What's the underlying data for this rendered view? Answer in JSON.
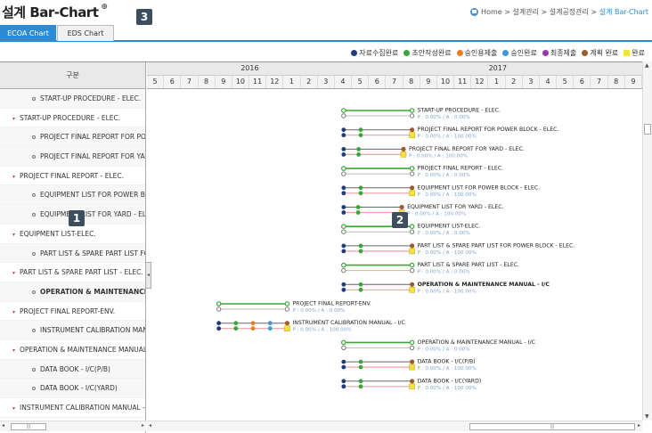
{
  "header": {
    "title": "설계 Bar-Chart",
    "title_mark": "⊕",
    "breadcrumb": {
      "home": "Home",
      "l1": "설계관리",
      "l2": "설계공정관리",
      "current": "설계 Bar-Chart",
      "sep": " > "
    }
  },
  "badges": [
    "1",
    "2",
    "3"
  ],
  "tabs": [
    {
      "label": "ECOA Chart",
      "active": true
    },
    {
      "label": "EDS Chart",
      "active": false
    }
  ],
  "legend": [
    {
      "label": "자료수집완료",
      "color": "#1f3c7a",
      "shape": "dot"
    },
    {
      "label": "초안작성완료",
      "color": "#3aa63a",
      "shape": "dot"
    },
    {
      "label": "승인용제출",
      "color": "#ee7d20",
      "shape": "dot"
    },
    {
      "label": "승인완료",
      "color": "#3a9ad9",
      "shape": "dot"
    },
    {
      "label": "최종제출",
      "color": "#9b33b5",
      "shape": "dot"
    },
    {
      "label": "계획 완료",
      "color": "#a05a2c",
      "shape": "dot"
    },
    {
      "label": "완료",
      "color": "#f4e43a",
      "shape": "square"
    }
  ],
  "left_header": "구분",
  "rows": [
    {
      "label": "START-UP PROCEDURE - ELEC.",
      "kind": "child"
    },
    {
      "label": "START-UP PROCEDURE - ELEC.",
      "kind": "parent"
    },
    {
      "label": "PROJECT FINAL REPORT FOR POWER BLOCK - ELEC.",
      "kind": "child"
    },
    {
      "label": "PROJECT FINAL REPORT FOR YARD - ELEC.",
      "kind": "child"
    },
    {
      "label": "PROJECT FINAL REPORT - ELEC.",
      "kind": "parent"
    },
    {
      "label": "EQUIPMENT LIST FOR POWER BLOCK - ELEC.",
      "kind": "child"
    },
    {
      "label": "EQUIPMENT LIST FOR YARD - ELEC.",
      "kind": "child"
    },
    {
      "label": "EQUIPMENT LIST-ELEC.",
      "kind": "parent"
    },
    {
      "label": "PART LIST & SPARE PART LIST FOR POWER BLOCK - ELEC.",
      "kind": "child"
    },
    {
      "label": "PART LIST & SPARE PART LIST - ELEC.",
      "kind": "parent"
    },
    {
      "label": "OPERATION & MAINTENANCE MANUAL - I/C",
      "kind": "child",
      "bold": true
    },
    {
      "label": "PROJECT FINAL REPORT-ENV.",
      "kind": "parent"
    },
    {
      "label": "INSTRUMENT CALIBRATION MANUAL - I/C",
      "kind": "child"
    },
    {
      "label": "OPERATION & MAINTENANCE MANUAL - I/C",
      "kind": "parent"
    },
    {
      "label": "DATA BOOK - I/C(P/B)",
      "kind": "child"
    },
    {
      "label": "DATA BOOK - I/C(YARD)",
      "kind": "child"
    },
    {
      "label": "INSTRUMENT CALIBRATION MANUAL - I/C",
      "kind": "parent"
    }
  ],
  "timeline": {
    "years": [
      {
        "label": "2016",
        "start_index": 0,
        "span": 12
      },
      {
        "label": "2017",
        "start_index": 12,
        "span": 17
      }
    ],
    "months": [
      "5",
      "6",
      "7",
      "8",
      "9",
      "10",
      "11",
      "12",
      "1",
      "2",
      "3",
      "4",
      "5",
      "6",
      "7",
      "8",
      "9",
      "10",
      "11",
      "12",
      "1",
      "2",
      "3",
      "4",
      "5",
      "6",
      "7",
      "8",
      "9"
    ]
  },
  "bars": [
    {
      "title": "START-UP PROCEDURE - ELEC.",
      "status": "P : 0.00% / A : 0.00%",
      "start": 11.5,
      "end": 15.5,
      "type": "plain",
      "bold": false
    },
    {
      "title": "PROJECT FINAL REPORT FOR POWER BLOCK - ELEC.",
      "status": "P : 0.00% / A : 100.00%",
      "start": 11.5,
      "end": 15.5,
      "type": "dots",
      "bold": false
    },
    {
      "title": "PROJECT FINAL REPORT FOR YARD - ELEC.",
      "status": "P : 0.00% / A : 100.00%",
      "start": 11.5,
      "end": 15.0,
      "type": "dots",
      "bold": false
    },
    {
      "title": "PROJECT FINAL REPORT - ELEC.",
      "status": "P : 0.00% / A : 0.00%",
      "start": 11.5,
      "end": 15.5,
      "type": "plain",
      "bold": false
    },
    {
      "title": "EQUIPMENT LIST FOR POWER BLOCK - ELEC.",
      "status": "P : 0.00% / A : 100.00%",
      "start": 11.5,
      "end": 15.5,
      "type": "dots",
      "bold": false
    },
    {
      "title": "EQUIPMENT LIST FOR YARD - ELEC.",
      "status": "P : 0.00% / A : 100.00%",
      "start": 11.5,
      "end": 14.9,
      "type": "dots",
      "bold": false
    },
    {
      "title": "EQUIPMENT LIST-ELEC.",
      "status": "P : 0.00% / A : 0.00%",
      "start": 11.5,
      "end": 15.5,
      "type": "plain",
      "bold": false
    },
    {
      "title": "PART LIST & SPARE PART LIST FOR POWER BLOCK - ELEC.",
      "status": "P : 0.00% / A : 100.00%",
      "start": 11.5,
      "end": 15.5,
      "type": "dots",
      "bold": false
    },
    {
      "title": "PART LIST & SPARE PART LIST - ELEC.",
      "status": "P : 0.00% / A : 0.00%",
      "start": 11.5,
      "end": 15.5,
      "type": "plain",
      "bold": false
    },
    {
      "title": "OPERATION & MAINTENANCE MANUAL - I/C",
      "status": "P : 0.00% / A : 100.00%",
      "start": 11.5,
      "end": 15.5,
      "type": "dots",
      "bold": true
    },
    {
      "title": "PROJECT FINAL REPORT-ENV.",
      "status": "P : 0.00% / A : 0.00%",
      "start": 4.2,
      "end": 8.2,
      "type": "plain",
      "bold": false
    },
    {
      "title": "INSTRUMENT CALIBRATION MANUAL - I/C",
      "status": "P : 0.00% / A : 100.00%",
      "start": 4.2,
      "end": 8.2,
      "type": "many",
      "bold": false
    },
    {
      "title": "OPERATION & MAINTENANCE MANUAL - I/C",
      "status": "P : 0.00% / A : 0.00%",
      "start": 11.5,
      "end": 15.5,
      "type": "plain",
      "bold": false
    },
    {
      "title": "DATA BOOK - I/C(P/B)",
      "status": "P : 0.00% / A : 100.00%",
      "start": 11.5,
      "end": 15.5,
      "type": "dots",
      "bold": false
    },
    {
      "title": "DATA BOOK - I/C(YARD)",
      "status": "P : 0.00% / A : 100.00%",
      "start": 11.5,
      "end": 15.5,
      "type": "dots",
      "bold": false
    }
  ],
  "scroll": {
    "left_thumb_label": "|||",
    "right_thumb_label": "|||"
  }
}
